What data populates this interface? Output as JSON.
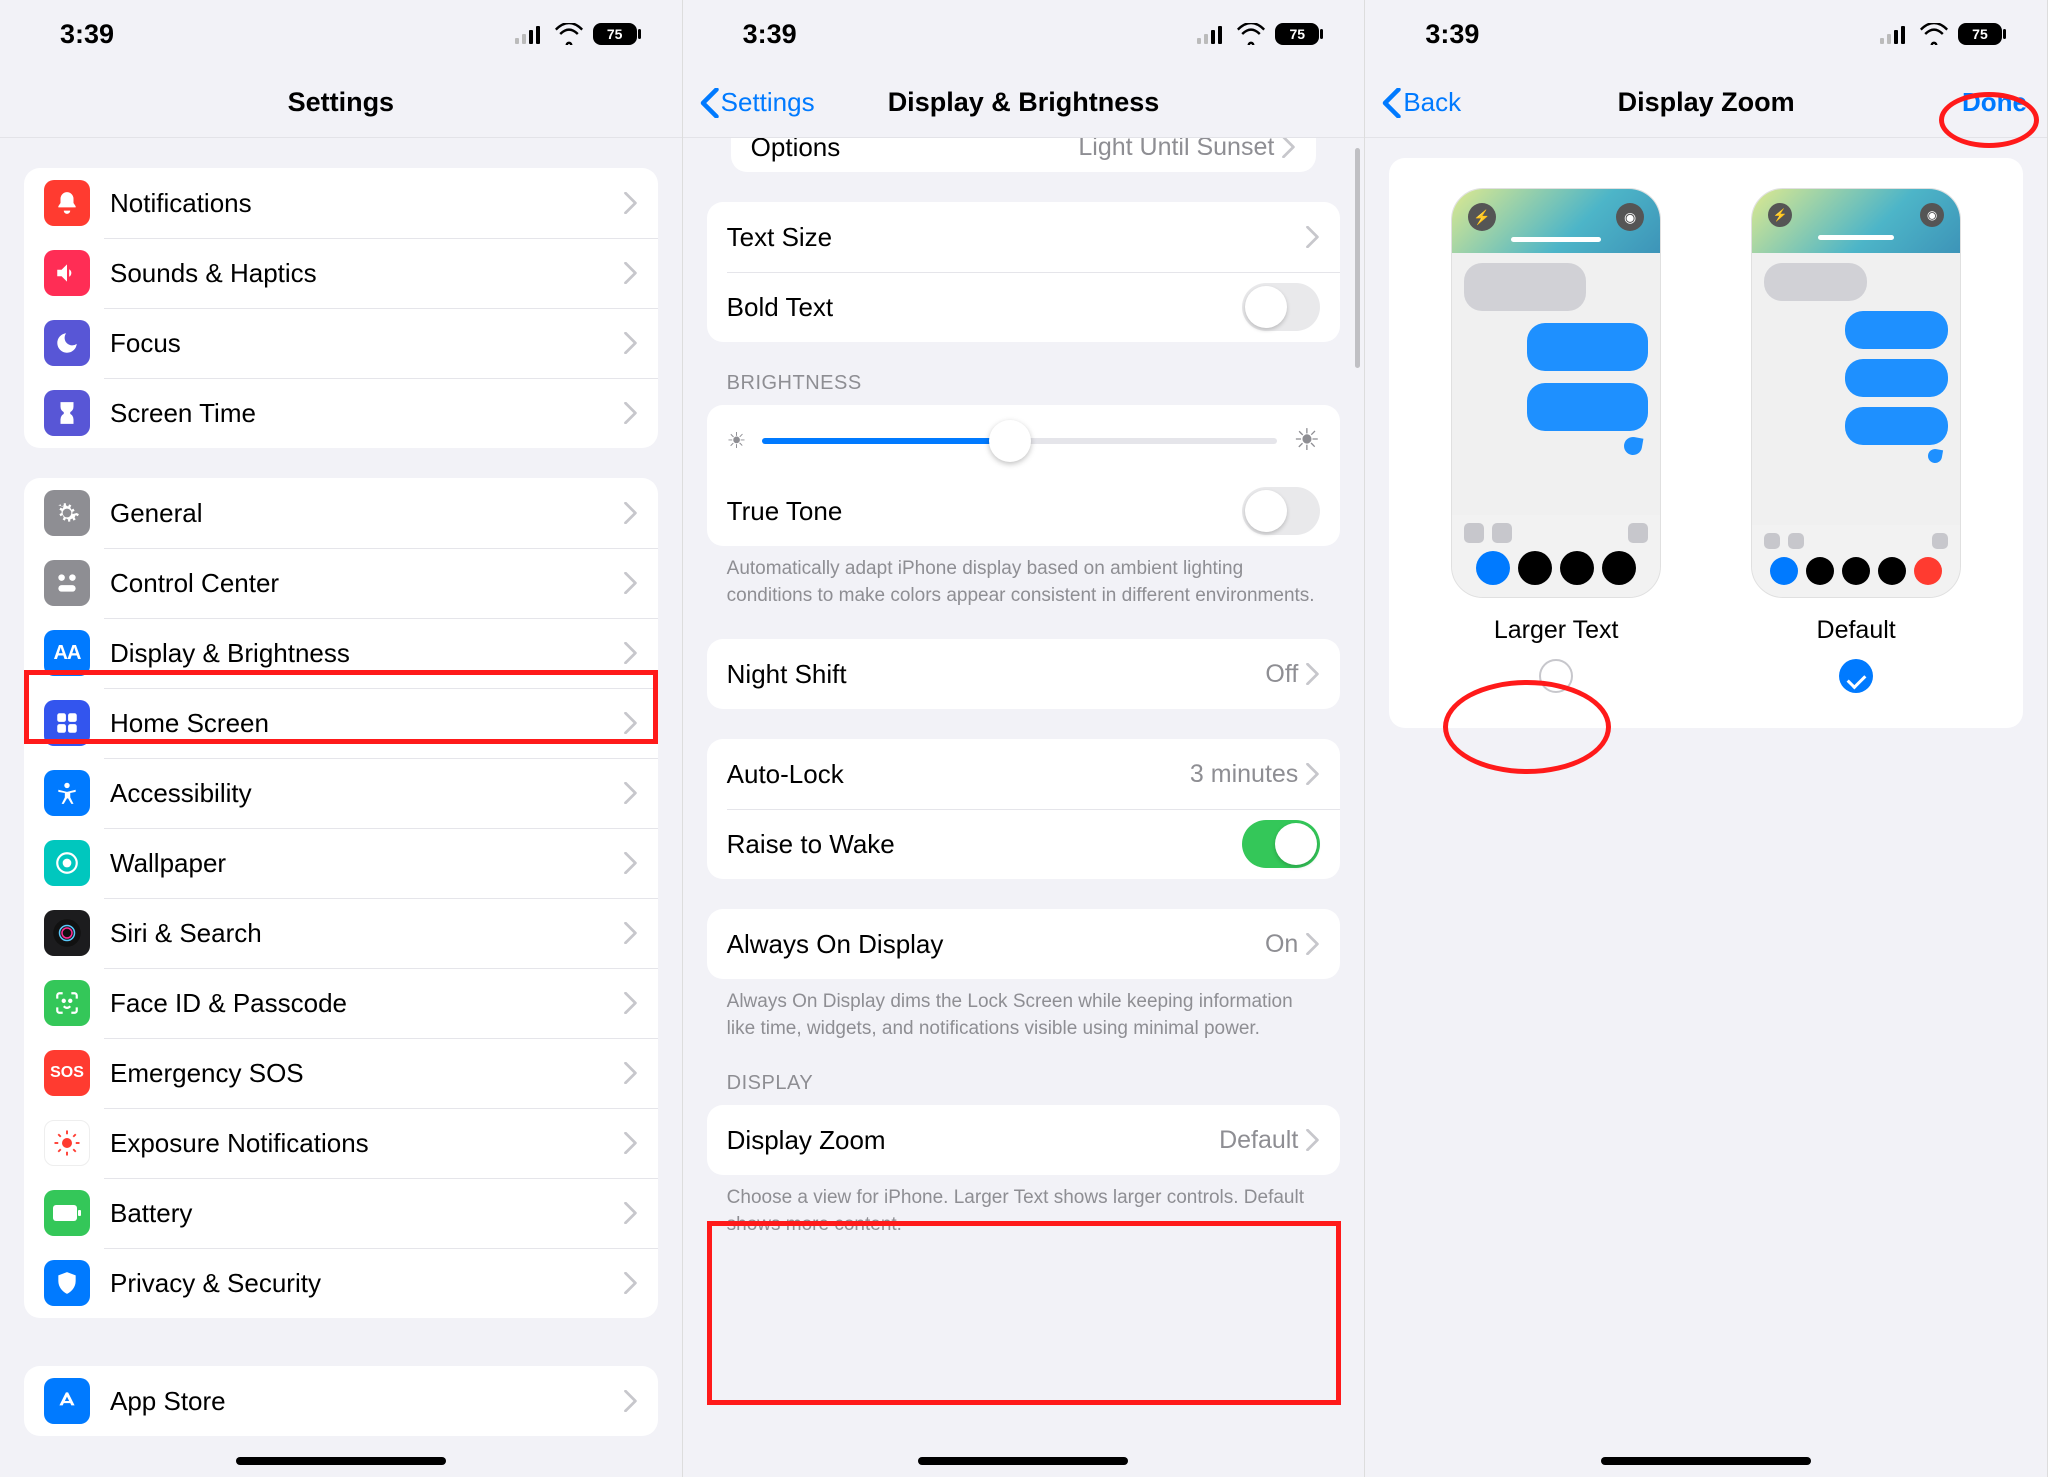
{
  "status": {
    "time": "3:39",
    "battery": "75"
  },
  "panel1": {
    "title": "Settings",
    "group1": [
      {
        "key": "notifications",
        "label": "Notifications",
        "color": "#ff3b30"
      },
      {
        "key": "sounds",
        "label": "Sounds & Haptics",
        "color": "#ff2d55"
      },
      {
        "key": "focus",
        "label": "Focus",
        "color": "#5856d6"
      },
      {
        "key": "screentime",
        "label": "Screen Time",
        "color": "#5856d6"
      }
    ],
    "group2": [
      {
        "key": "general",
        "label": "General",
        "color": "#8e8e93"
      },
      {
        "key": "controlcenter",
        "label": "Control Center",
        "color": "#8e8e93"
      },
      {
        "key": "display",
        "label": "Display & Brightness",
        "color": "#007aff",
        "highlight": true
      },
      {
        "key": "homescreen",
        "label": "Home Screen",
        "color": "#3355ee"
      },
      {
        "key": "accessibility",
        "label": "Accessibility",
        "color": "#007aff"
      },
      {
        "key": "wallpaper",
        "label": "Wallpaper",
        "color": "#00c7be"
      },
      {
        "key": "siri",
        "label": "Siri & Search",
        "color": "#1c1c1e"
      },
      {
        "key": "faceid",
        "label": "Face ID & Passcode",
        "color": "#34c759"
      },
      {
        "key": "sos",
        "label": "Emergency SOS",
        "color": "#ff3b30"
      },
      {
        "key": "exposure",
        "label": "Exposure Notifications",
        "color": "#ffffff"
      },
      {
        "key": "battery",
        "label": "Battery",
        "color": "#34c759"
      },
      {
        "key": "privacy",
        "label": "Privacy & Security",
        "color": "#007aff"
      }
    ],
    "group3": [
      {
        "key": "appstore",
        "label": "App Store",
        "color": "#007aff"
      }
    ]
  },
  "panel2": {
    "back": "Settings",
    "title": "Display & Brightness",
    "partial": {
      "label": "Options",
      "value": "Light Until Sunset"
    },
    "textSize": "Text Size",
    "boldText": "Bold Text",
    "brightnessHeader": "BRIGHTNESS",
    "trueTone": "True Tone",
    "trueToneFooter": "Automatically adapt iPhone display based on ambient lighting conditions to make colors appear consistent in different environments.",
    "nightShift": {
      "label": "Night Shift",
      "value": "Off"
    },
    "autoLock": {
      "label": "Auto-Lock",
      "value": "3 minutes"
    },
    "raiseToWake": "Raise to Wake",
    "alwaysOn": {
      "label": "Always On Display",
      "value": "On"
    },
    "alwaysOnFooter": "Always On Display dims the Lock Screen while keeping information like time, widgets, and notifications visible using minimal power.",
    "displayHeader": "DISPLAY",
    "displayZoom": {
      "label": "Display Zoom",
      "value": "Default"
    },
    "displayZoomFooter": "Choose a view for iPhone. Larger Text shows larger controls. Default shows more content."
  },
  "panel3": {
    "back": "Back",
    "title": "Display Zoom",
    "done": "Done",
    "options": {
      "larger": "Larger Text",
      "default": "Default"
    }
  }
}
